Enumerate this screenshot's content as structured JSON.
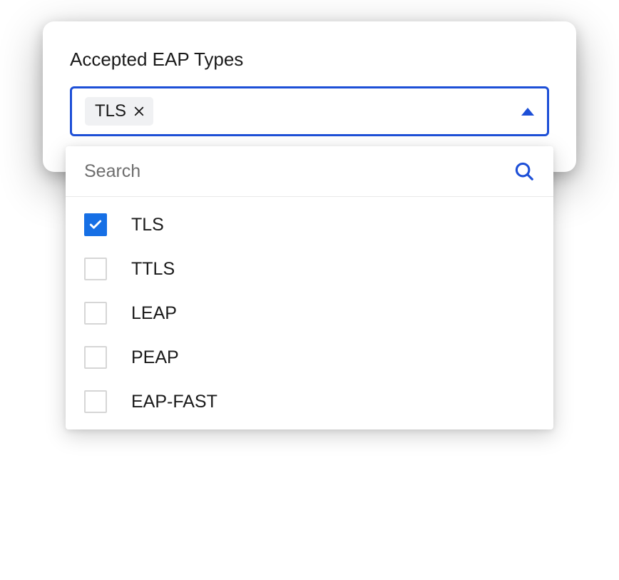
{
  "field": {
    "label": "Accepted EAP Types"
  },
  "selected": {
    "tags": [
      {
        "label": "TLS"
      }
    ]
  },
  "search": {
    "placeholder": "Search",
    "value": ""
  },
  "options": [
    {
      "label": "TLS",
      "checked": true
    },
    {
      "label": "TTLS",
      "checked": false
    },
    {
      "label": "LEAP",
      "checked": false
    },
    {
      "label": "PEAP",
      "checked": false
    },
    {
      "label": "EAP-FAST",
      "checked": false
    }
  ],
  "colors": {
    "primary": "#1d4fd7",
    "checkboxChecked": "#166fe5"
  }
}
